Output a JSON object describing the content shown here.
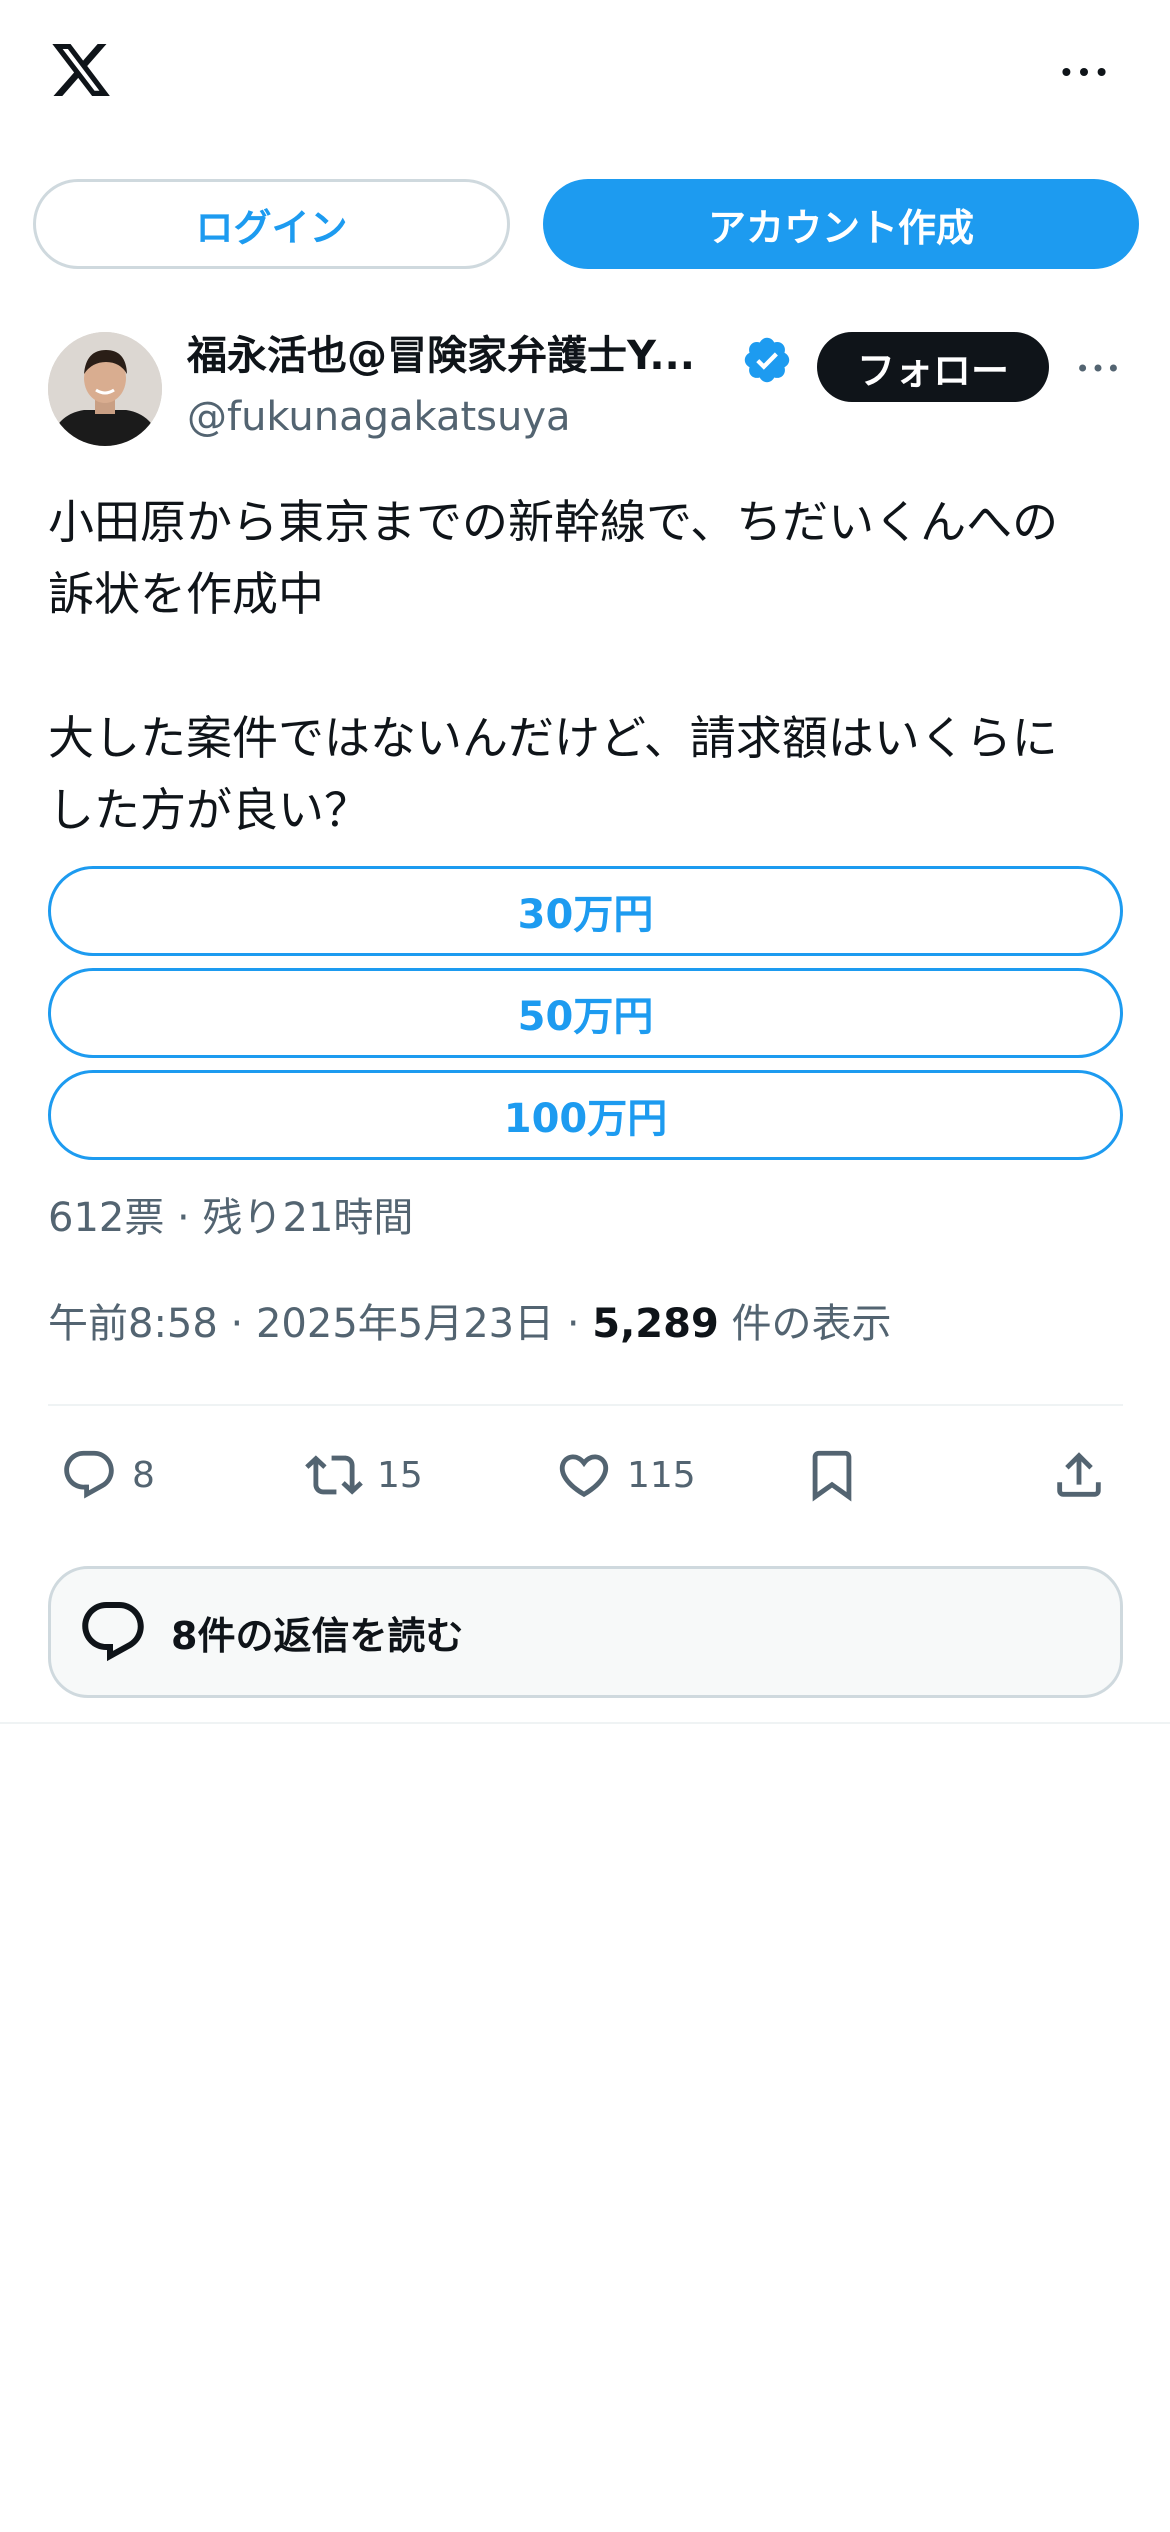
{
  "header": {
    "logo_icon": "x-logo-icon",
    "more_icon": "more-horizontal-icon"
  },
  "auth": {
    "login_label": "ログイン",
    "signup_label": "アカウント作成"
  },
  "post": {
    "author": {
      "name": "福永活也@冒険家弁護士Y...",
      "handle": "@fukunagakatsuya",
      "verified": true
    },
    "follow_label": "フォロー",
    "text": "小田原から東京までの新幹線で、ちだいくんへの\n訴状を作成中\n\n大した案件ではないんだけど、請求額はいくらに\nした方が良い？",
    "poll": {
      "options": [
        "30万円",
        "50万円",
        "100万円"
      ],
      "meta": "612票 · 残り21時間"
    },
    "timestamp": {
      "time_date": "午前8:58 · 2025年5月23日 · ",
      "views": "5,289",
      "views_label": " 件の表示"
    },
    "actions": {
      "replies": "8",
      "reposts": "15",
      "likes": "115"
    },
    "read_replies_label": "8件の返信を読む"
  },
  "colors": {
    "accent": "#1d9bf0",
    "text": "#0f1419",
    "secondary_text": "#536471",
    "border": "#cfd9de"
  }
}
